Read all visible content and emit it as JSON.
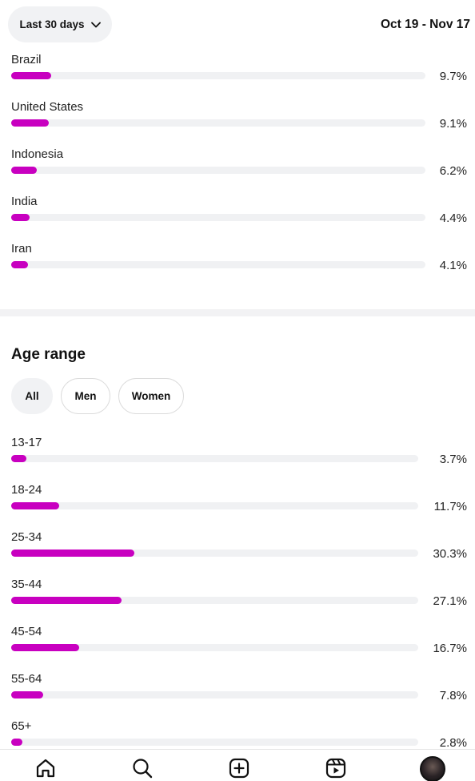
{
  "header": {
    "range_label": "Last 30 days",
    "date_range": "Oct 19 - Nov 17"
  },
  "countries": [
    {
      "label": "Brazil",
      "percent_text": "9.7%",
      "value": 9.7
    },
    {
      "label": "United States",
      "percent_text": "9.1%",
      "value": 9.1
    },
    {
      "label": "Indonesia",
      "percent_text": "6.2%",
      "value": 6.2
    },
    {
      "label": "India",
      "percent_text": "4.4%",
      "value": 4.4
    },
    {
      "label": "Iran",
      "percent_text": "4.1%",
      "value": 4.1
    }
  ],
  "age_section": {
    "title": "Age range",
    "filters": [
      "All",
      "Men",
      "Women"
    ],
    "selected_filter": "All",
    "rows": [
      {
        "label": "13-17",
        "percent_text": "3.7%",
        "value": 3.7
      },
      {
        "label": "18-24",
        "percent_text": "11.7%",
        "value": 11.7
      },
      {
        "label": "25-34",
        "percent_text": "30.3%",
        "value": 30.3
      },
      {
        "label": "35-44",
        "percent_text": "27.1%",
        "value": 27.1
      },
      {
        "label": "45-54",
        "percent_text": "16.7%",
        "value": 16.7
      },
      {
        "label": "55-64",
        "percent_text": "7.8%",
        "value": 7.8
      },
      {
        "label": "65+",
        "percent_text": "2.8%",
        "value": 2.8
      }
    ]
  },
  "bottom_nav": {
    "items": [
      "home-icon",
      "search-icon",
      "create-icon",
      "reels-icon",
      "profile-avatar"
    ]
  },
  "colors": {
    "bar_fill": "#c800c0",
    "bar_track": "#f0f1f3",
    "chip_active_bg": "#f1f2f4"
  }
}
